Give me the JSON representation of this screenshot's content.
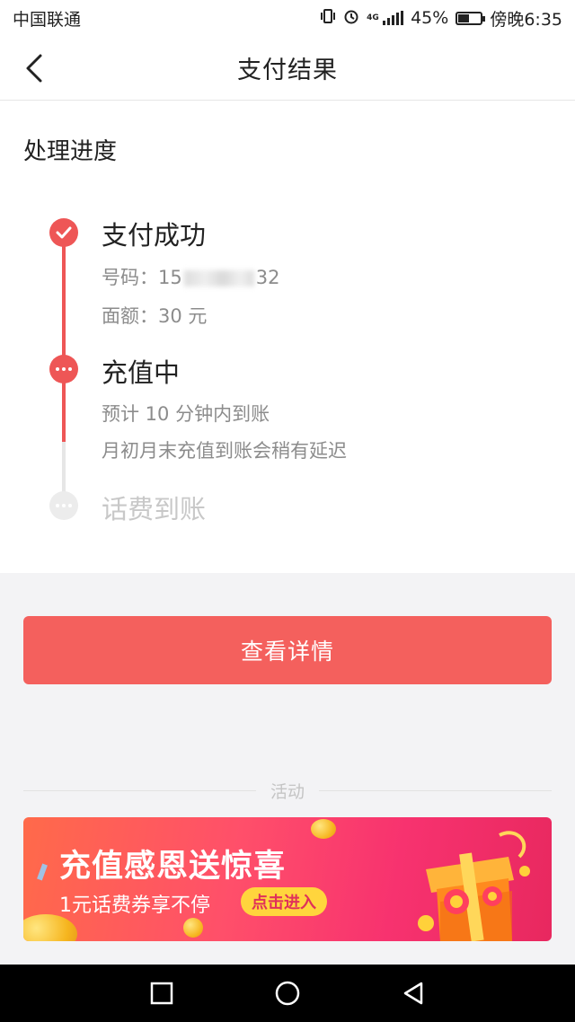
{
  "status_bar": {
    "carrier": "中国联通",
    "network": "4G",
    "battery": "45%",
    "battery_level": 0.45,
    "time": "傍晚6:35"
  },
  "header": {
    "title": "支付结果",
    "back_icon": "chevron-left-icon"
  },
  "progress": {
    "title": "处理进度",
    "steps": [
      {
        "title": "支付成功",
        "status": "done",
        "icon": "check-icon",
        "details": [
          {
            "label": "号码：",
            "value_start": "15",
            "value_end": "32"
          },
          {
            "label": "面额：",
            "value": "30 元"
          }
        ]
      },
      {
        "title": "充值中",
        "status": "in-progress",
        "icon": "more-dots-icon",
        "details": [
          {
            "text": "预计 10 分钟内到账"
          },
          {
            "text": "月初月末充值到账会稍有延迟"
          }
        ]
      },
      {
        "title": "话费到账",
        "status": "pending",
        "icon": "more-dots-icon"
      }
    ]
  },
  "actions": {
    "details_button": "查看详情"
  },
  "activity": {
    "section_label": "活动",
    "banner": {
      "title": "充值感恩送惊喜",
      "subtitle": "1元话费券享不停",
      "cta": "点击进入"
    }
  },
  "colors": {
    "accent": "#f4605d",
    "timeline_active": "#ee5656",
    "timeline_pending": "#e6e6e6",
    "banner_cta": "#ffd53d"
  },
  "system_nav": {
    "icons": [
      "square-recents-icon",
      "circle-home-icon",
      "triangle-back-icon"
    ]
  }
}
